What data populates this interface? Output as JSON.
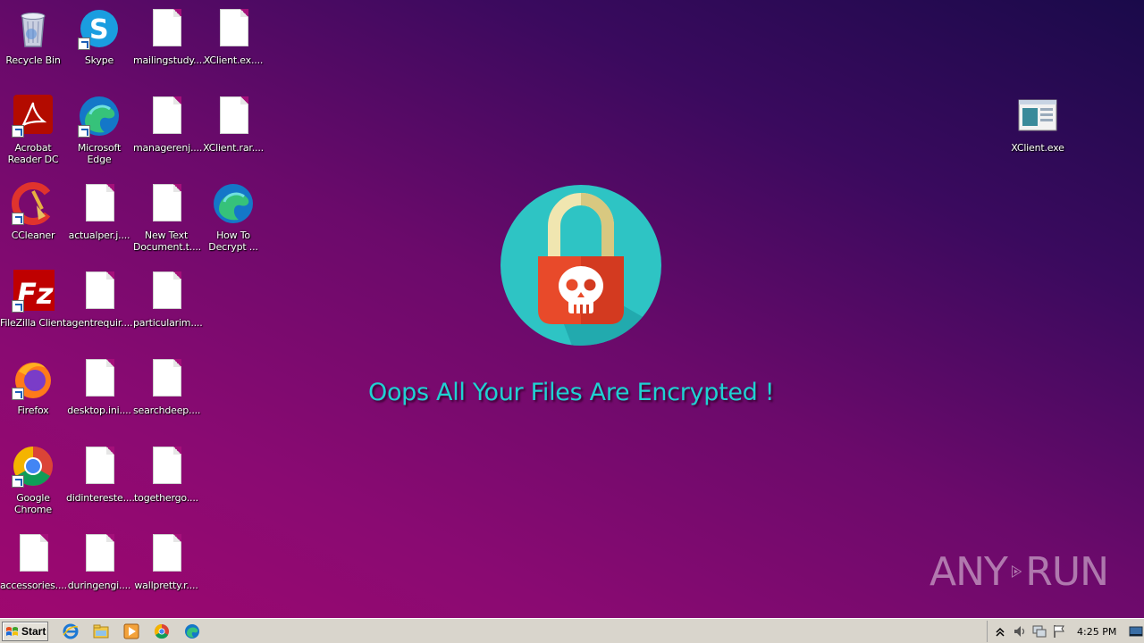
{
  "desktop": {
    "icons": [
      {
        "label": "Recycle Bin",
        "icon": "recycle-bin-icon"
      },
      {
        "label": "Skype",
        "icon": "skype-icon"
      },
      {
        "label": "mailingstudy....",
        "icon": "file-icon"
      },
      {
        "label": "XClient.ex....",
        "icon": "file-icon"
      },
      {
        "label": "Acrobat Reader DC",
        "icon": "acrobat-icon"
      },
      {
        "label": "Microsoft Edge",
        "icon": "edge-icon"
      },
      {
        "label": "managerenj....",
        "icon": "file-icon"
      },
      {
        "label": "XClient.rar....",
        "icon": "file-icon"
      },
      {
        "label": "CCleaner",
        "icon": "ccleaner-icon"
      },
      {
        "label": "actualper.j....",
        "icon": "file-icon"
      },
      {
        "label": "New Text Document.t....",
        "icon": "file-icon"
      },
      {
        "label": "How To Decrypt ...",
        "icon": "edge-icon"
      },
      {
        "label": "FileZilla Client",
        "icon": "filezilla-icon"
      },
      {
        "label": "agentrequir....",
        "icon": "file-icon"
      },
      {
        "label": "particularim....",
        "icon": "file-icon"
      },
      {
        "label": "Firefox",
        "icon": "firefox-icon"
      },
      {
        "label": "desktop.ini....",
        "icon": "file-icon"
      },
      {
        "label": "searchdeep....",
        "icon": "file-icon"
      },
      {
        "label": "Google Chrome",
        "icon": "chrome-icon"
      },
      {
        "label": "didintereste....",
        "icon": "file-icon"
      },
      {
        "label": "togethergo....",
        "icon": "file-icon"
      },
      {
        "label": "accessories....",
        "icon": "file-icon"
      },
      {
        "label": "duringengi....",
        "icon": "file-icon"
      },
      {
        "label": "wallpretty.r....",
        "icon": "file-icon"
      },
      {
        "label": "XClient.exe",
        "icon": "exe-window-icon"
      }
    ],
    "ransom_message": "Oops All Your Files Are Encrypted !",
    "watermark_left": "ANY",
    "watermark_right": "RUN"
  },
  "taskbar": {
    "start_label": "Start",
    "pinned": [
      "ie-icon",
      "explorer-icon",
      "media-player-icon",
      "chrome-icon",
      "edge-icon"
    ],
    "clock": "4:25 PM"
  },
  "colors": {
    "message": "#1fd2d2",
    "lock_circle": "#2ec4c4",
    "lock_body": "#e84a2a"
  }
}
